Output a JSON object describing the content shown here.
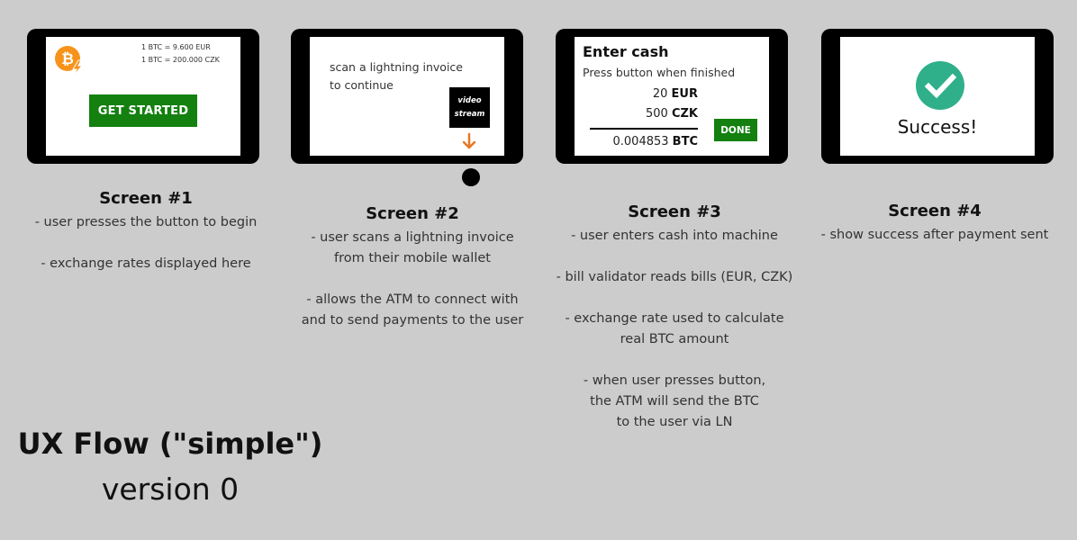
{
  "screens": [
    {
      "rates": [
        "1 BTC = 9.600 EUR",
        "1 BTC = 200.000 CZK"
      ],
      "button_label": "GET STARTED",
      "caption_title": "Screen #1",
      "caption_lines": [
        "- user presses the button to begin",
        "",
        "- exchange rates displayed here"
      ]
    },
    {
      "scan_text_line1": "scan a lightning invoice",
      "scan_text_line2": "to continue",
      "video_label_line1": "video",
      "video_label_line2": "stream",
      "caption_title": "Screen #2",
      "caption_lines": [
        "- user scans a lightning invoice",
        "from their mobile wallet",
        "",
        "- allows the ATM to connect with",
        "and to send payments to the user"
      ]
    },
    {
      "heading": "Enter cash",
      "instruction": "Press button when finished",
      "amounts": [
        {
          "value": "20",
          "unit": "EUR"
        },
        {
          "value": "500",
          "unit": "CZK"
        },
        {
          "value": "0.004853",
          "unit": "BTC"
        }
      ],
      "done_label": "DONE",
      "caption_title": "Screen #3",
      "caption_lines": [
        "- user enters cash into machine",
        "",
        "- bill validator reads bills (EUR, CZK)",
        "",
        "- exchange rate used to calculate",
        "real BTC amount",
        "",
        "- when user presses button,",
        "the ATM will send the BTC",
        "to the user via LN"
      ]
    },
    {
      "message": "Success!",
      "caption_title": "Screen #4",
      "caption_lines": [
        "- show success after payment sent"
      ]
    }
  ],
  "title": "UX Flow (\"simple\")",
  "subtitle": "version 0",
  "colors": {
    "background": "#cccccc",
    "device": "#000000",
    "button_green": "#13800f",
    "bitcoin_orange": "#f7931a",
    "arrow_orange": "#e87722",
    "success_teal": "#2fb08a"
  }
}
